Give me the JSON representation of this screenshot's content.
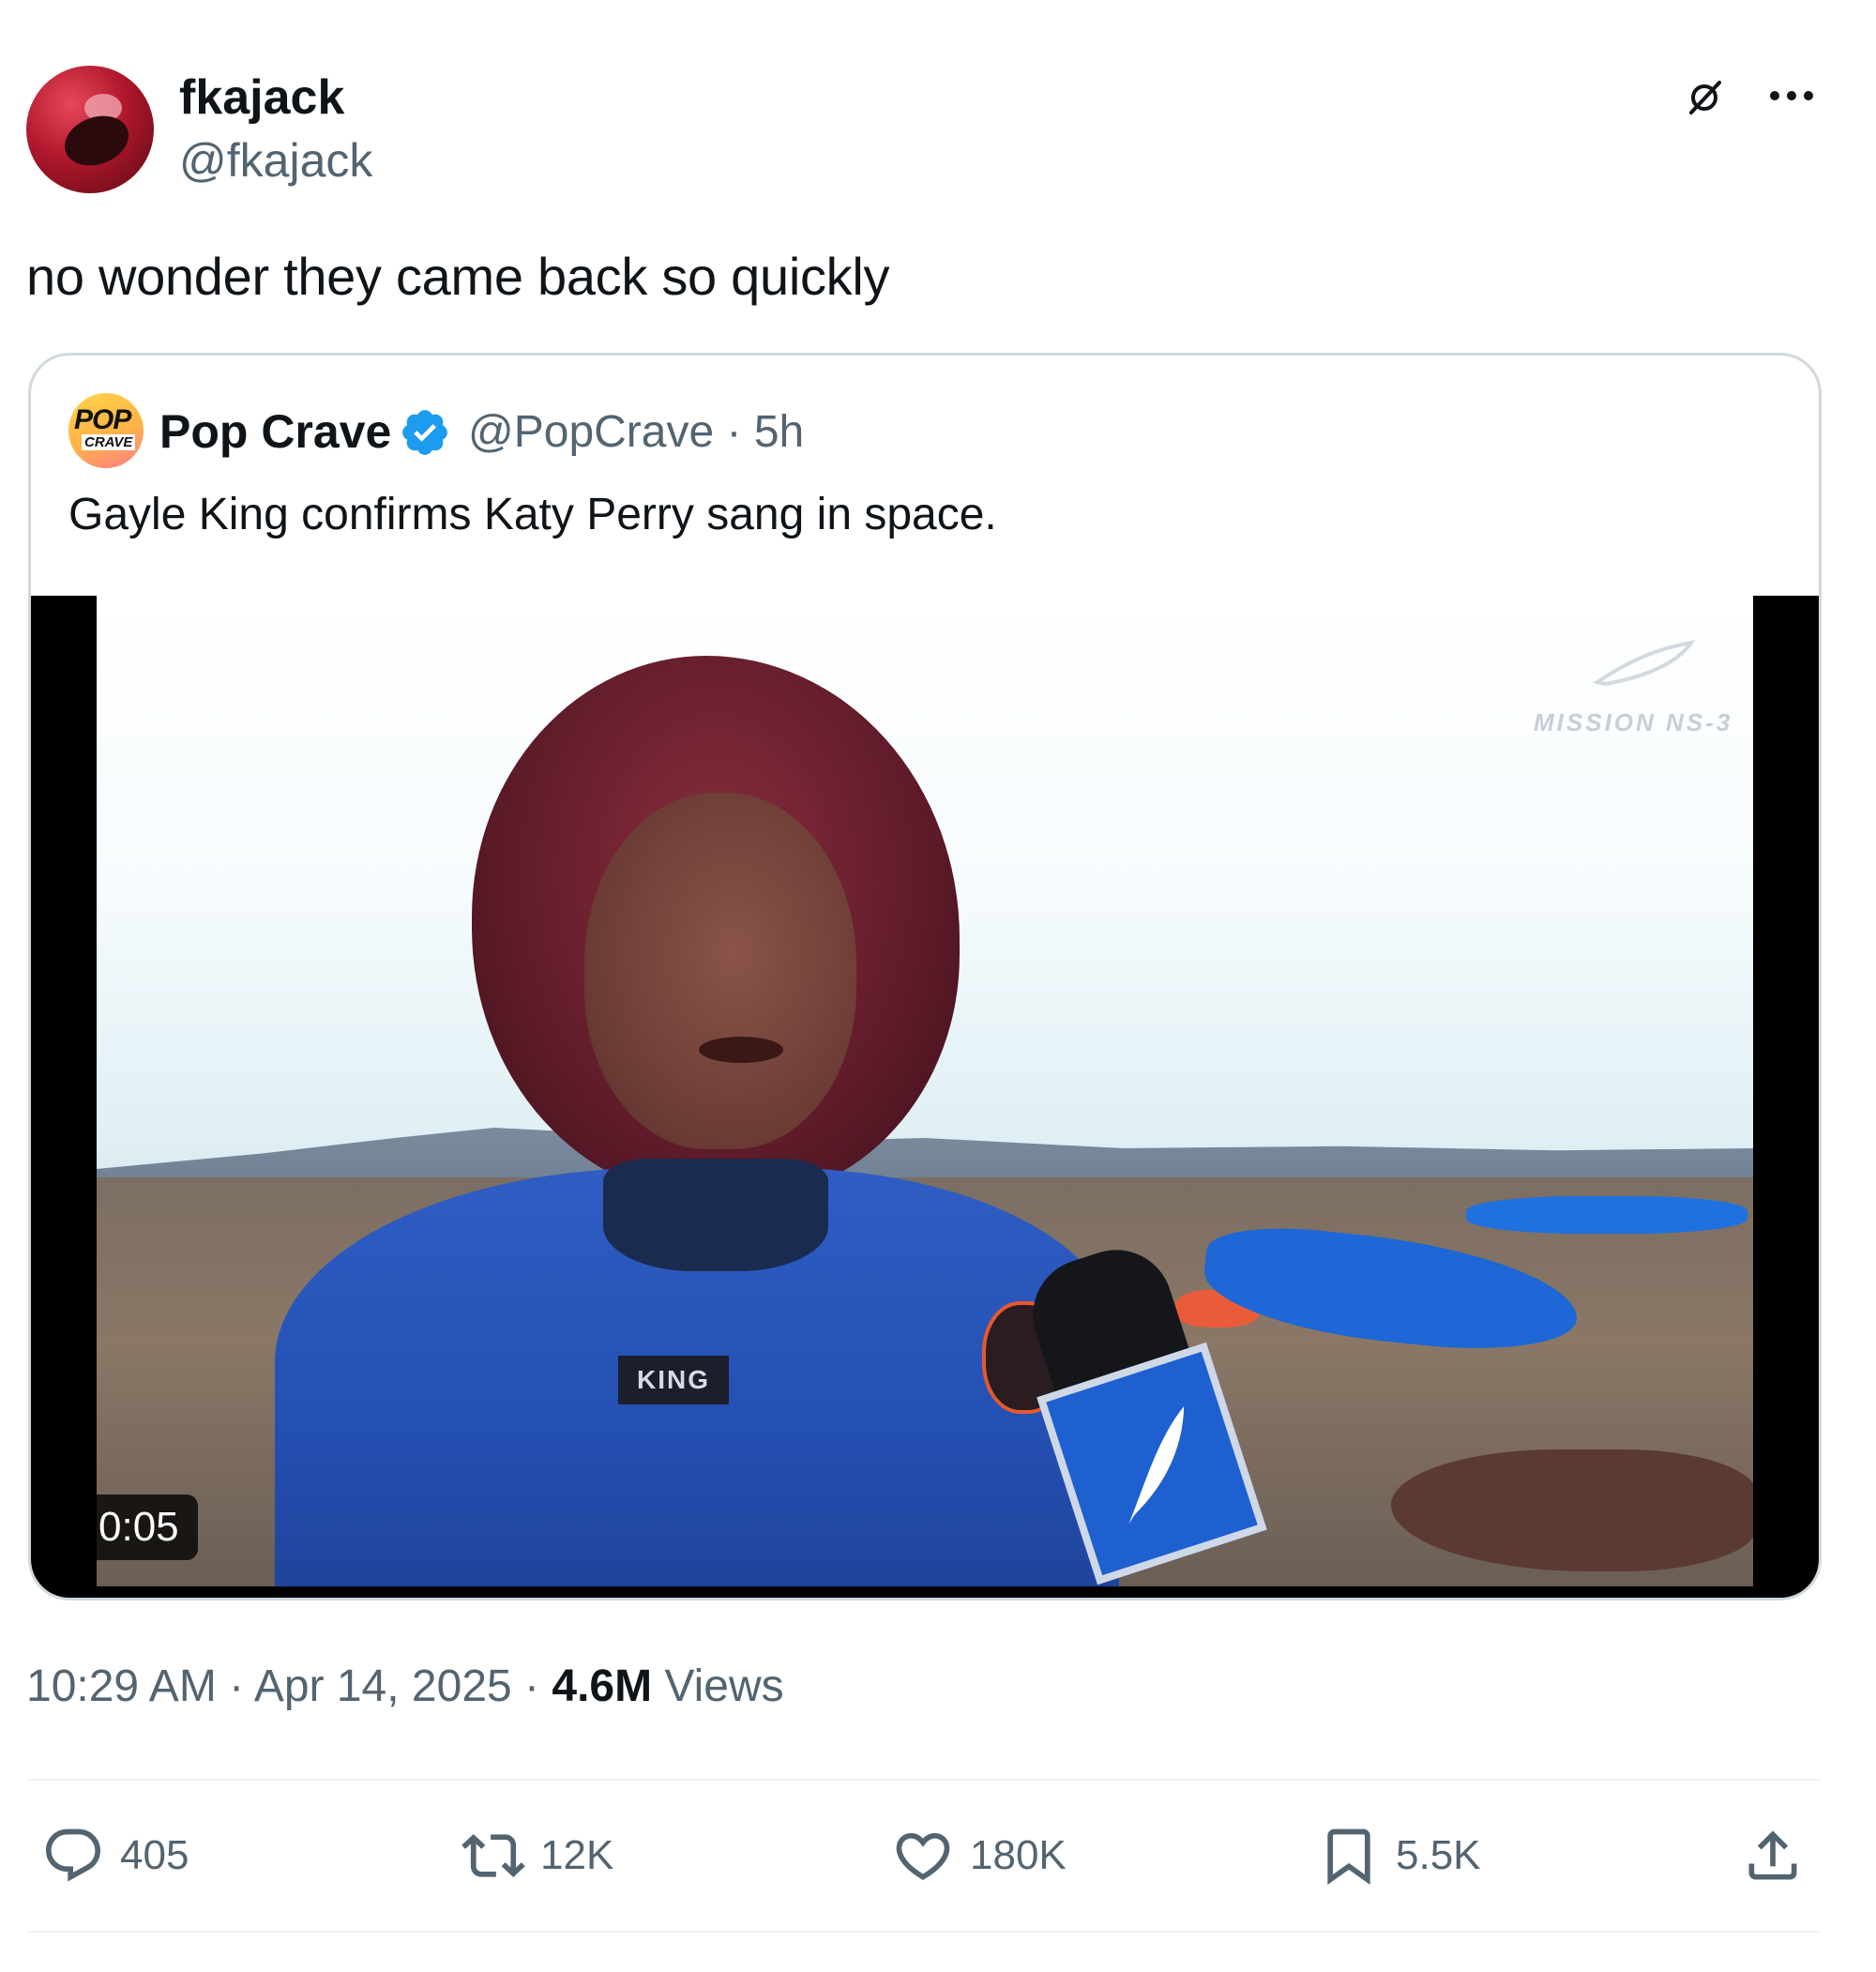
{
  "tweet": {
    "author": {
      "display_name": "fkajack",
      "handle": "@fkajack",
      "avatar_icon": "profile-avatar"
    },
    "text": "no wonder they came back so quickly",
    "quoted_tweet": {
      "author": {
        "display_name": "Pop Crave",
        "handle": "@PopCrave",
        "verified": true,
        "avatar_text_top": "POP",
        "avatar_text_bottom": "CRAVE"
      },
      "time_ago": "5h",
      "handle_time": "@PopCrave · 5h",
      "text": "Gayle King confirms Katy Perry sang in space.",
      "video": {
        "duration": "0:05",
        "name_tag": "KING",
        "watermark": "MISSION NS-3"
      }
    },
    "timestamp": "10:29 AM",
    "date": "Apr 14, 2025",
    "views_count": "4.6M",
    "views_label": "Views",
    "actions": {
      "replies": "405",
      "reposts": "12K",
      "likes": "180K",
      "bookmarks": "5.5K"
    }
  },
  "colors": {
    "text_primary": "#0f1419",
    "text_secondary": "#536471",
    "verified_blue": "#1d9bf0",
    "border": "#cfd9de"
  }
}
